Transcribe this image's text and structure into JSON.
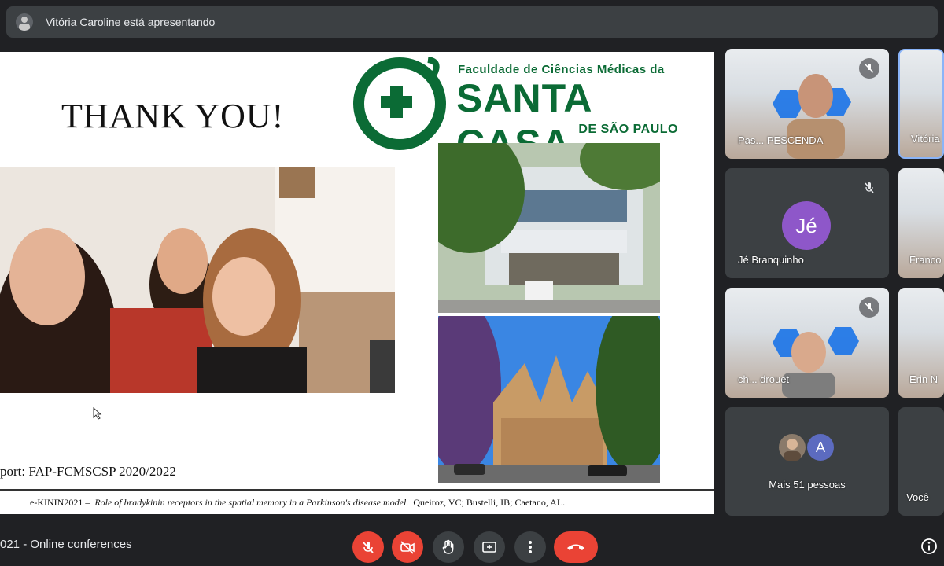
{
  "topbar": {
    "presenting_text": "Vitória Caroline está apresentando"
  },
  "slide": {
    "title": "THANK YOU!",
    "logo": {
      "line1": "Faculdade de Ciências Médicas da",
      "line2": "SANTA CASA",
      "line3": "DE SÃO PAULO"
    },
    "support_text": "port: FAP-FCMSCSP 2020/2022",
    "citation_event": "e-KININ2021 –",
    "citation_title": "Role of bradykinin receptors in the spatial memory in a Parkinson's disease model.",
    "citation_authors": "Queiroz, VC; Bustelli, IB; Caetano, AL."
  },
  "participants": [
    {
      "name": "Pas... PESCENDA",
      "icon": "none"
    },
    {
      "name": "Vitória",
      "icon": "none"
    },
    {
      "name": "Jé Branquinho",
      "initials": "Jé",
      "icon": "mic-off-icon",
      "avatar_color": "#8e57c9"
    },
    {
      "name": "Franco",
      "icon": "none"
    },
    {
      "name": "ch... drouet",
      "icon": "none"
    },
    {
      "name": "Erin N",
      "icon": "none"
    },
    {
      "name": "Mais 51 pessoas",
      "initials": "A",
      "avatar_color": "#5c6bc0"
    },
    {
      "name": "Você",
      "icon": "none"
    }
  ],
  "bottombar": {
    "meeting_title": "021 - Online conferences"
  },
  "controls": [
    {
      "name": "mic-off-icon",
      "state": "off"
    },
    {
      "name": "camera-off-icon",
      "state": "off"
    },
    {
      "name": "raise-hand-icon"
    },
    {
      "name": "present-icon"
    },
    {
      "name": "more-options-icon"
    },
    {
      "name": "hang-up-icon"
    },
    {
      "name": "info-icon"
    }
  ],
  "colors": {
    "background": "#202124",
    "tile": "#3c4043",
    "danger": "#ea4335",
    "brand_green": "#0b6b35"
  }
}
